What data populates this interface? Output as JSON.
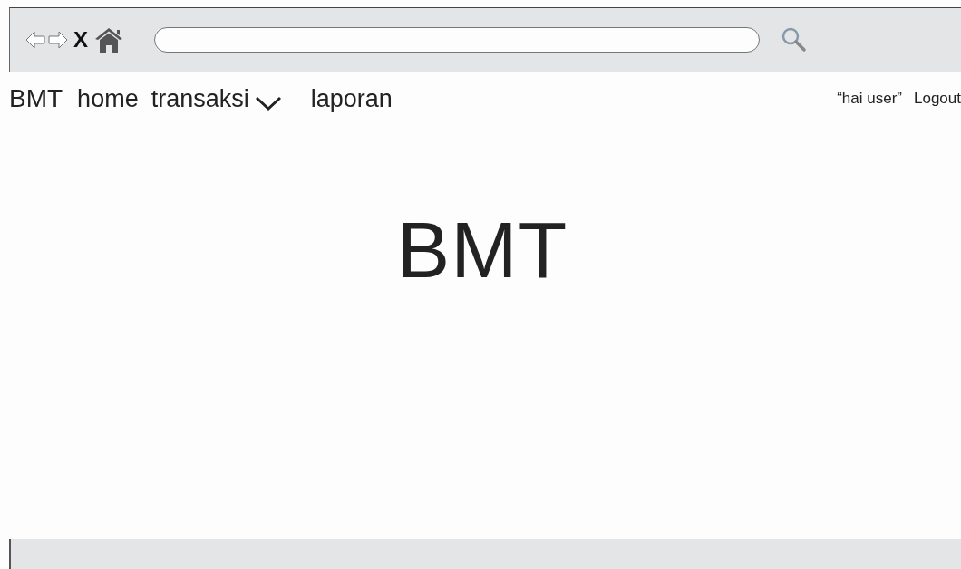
{
  "toolbar": {
    "stop_label": "X"
  },
  "nav": {
    "brand": "BMT",
    "items": [
      {
        "label": "home",
        "kind": "link"
      },
      {
        "label": "transaksi",
        "kind": "dropdown"
      },
      {
        "label": "laporan",
        "kind": "link"
      }
    ],
    "greeting": "“hai user”",
    "logout": "Logout"
  },
  "hero": {
    "title": "BMT"
  }
}
